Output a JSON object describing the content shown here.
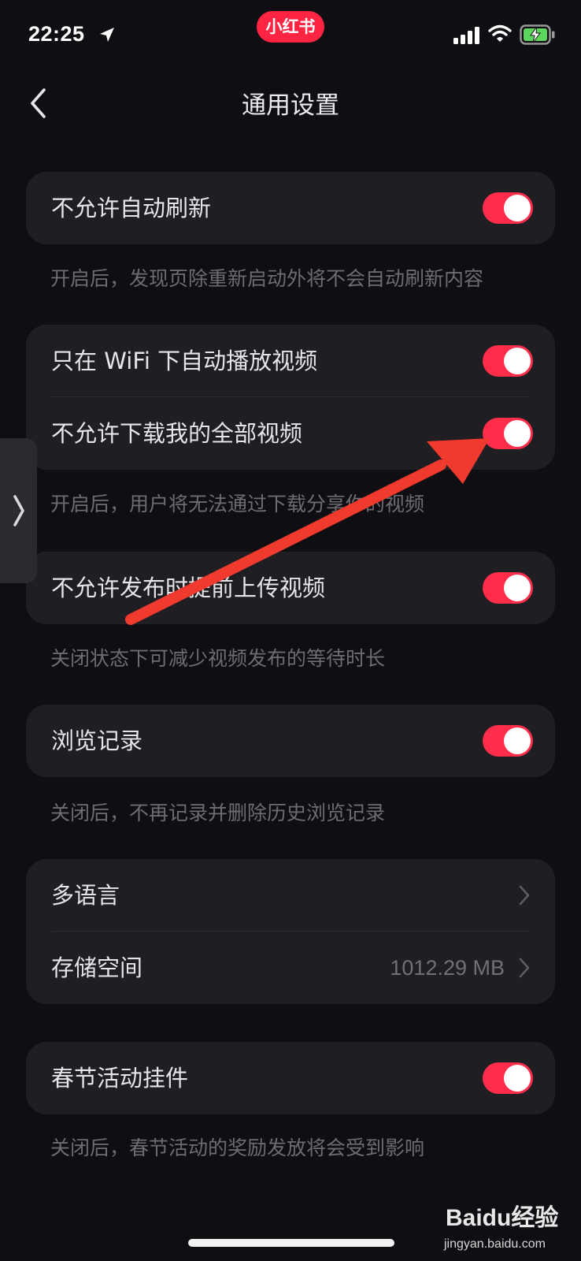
{
  "status_bar": {
    "time": "22:25",
    "app_badge": "小红书",
    "icons": [
      "location-arrow-icon",
      "cellular-signal-icon",
      "wifi-icon",
      "battery-charging-icon"
    ]
  },
  "header": {
    "title": "通用设置",
    "back_icon": "chevron-left-icon"
  },
  "groups": [
    {
      "rows": [
        {
          "label": "不允许自动刷新",
          "control": "toggle",
          "on": true
        }
      ],
      "hint": "开启后，发现页除重新启动外将不会自动刷新内容"
    },
    {
      "rows": [
        {
          "label": "只在 WiFi 下自动播放视频",
          "control": "toggle",
          "on": true
        },
        {
          "label": "不允许下载我的全部视频",
          "control": "toggle",
          "on": true
        }
      ],
      "hint": "开启后，用户将无法通过下载分享你的视频"
    },
    {
      "rows": [
        {
          "label": "不允许发布时提前上传视频",
          "control": "toggle",
          "on": true
        }
      ],
      "hint": "关闭状态下可减少视频发布的等待时长"
    },
    {
      "rows": [
        {
          "label": "浏览记录",
          "control": "toggle",
          "on": true
        }
      ],
      "hint": "关闭后，不再记录并删除历史浏览记录"
    },
    {
      "rows": [
        {
          "label": "多语言",
          "control": "chevron"
        },
        {
          "label": "存储空间",
          "control": "chevron",
          "value": "1012.29 MB"
        }
      ]
    },
    {
      "rows": [
        {
          "label": "春节活动挂件",
          "control": "toggle",
          "on": true
        }
      ],
      "hint": "关闭后，春节活动的奖励发放将会受到影响"
    }
  ],
  "overlays": {
    "side_handle_icon": "chevron-right-icon",
    "annotation_arrow_icon": "red-arrow-annotation-icon"
  },
  "watermark": {
    "brand": "Baidu经验",
    "site": "jingyan.baidu.com"
  },
  "colors": {
    "background": "#0f0f13",
    "card": "#1e1e23",
    "toggle_on": "#ff2c4a",
    "app_badge": "#ff2442",
    "hint_text": "#6c6c72",
    "annotation_arrow": "#f03a2e"
  }
}
